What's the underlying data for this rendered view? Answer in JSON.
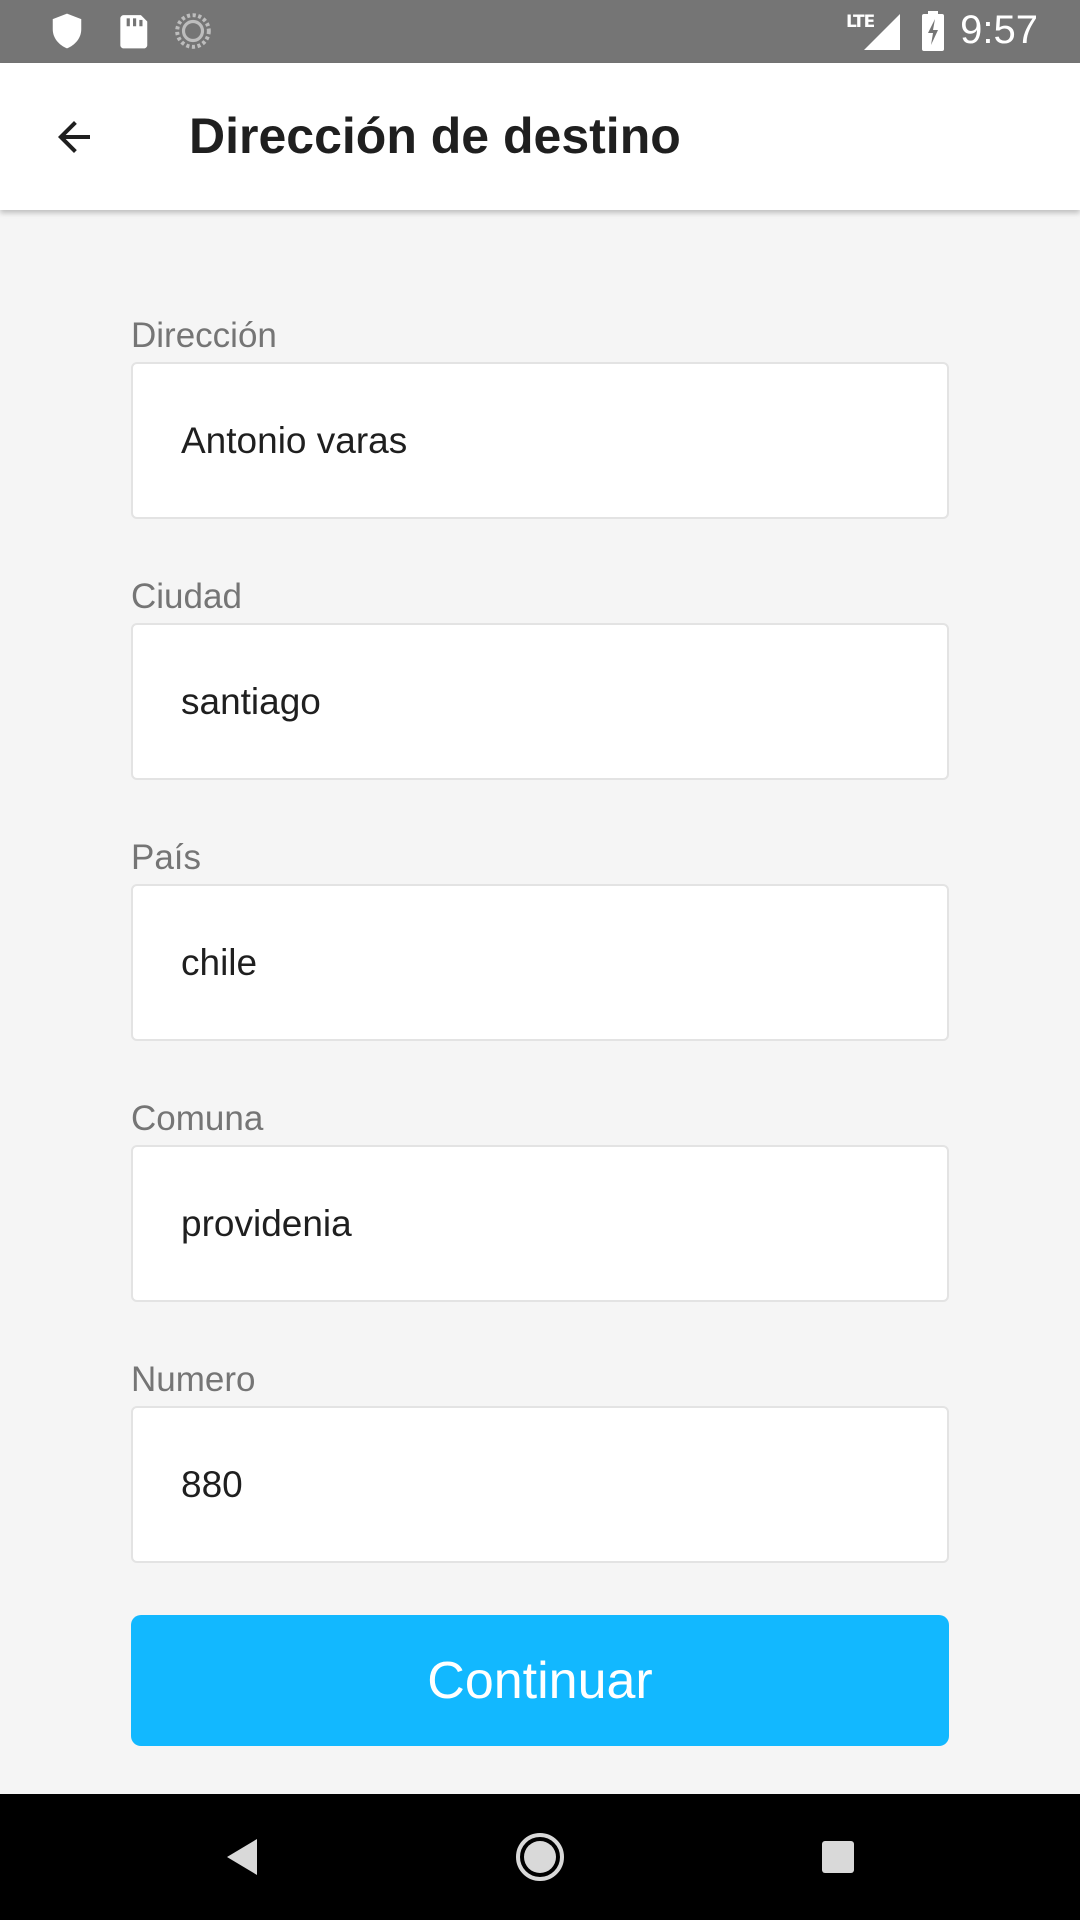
{
  "status_bar": {
    "time": "9:57",
    "network": "LTE",
    "icons": [
      "shield-icon",
      "sd-card-icon",
      "sync-icon",
      "signal-icon",
      "battery-charging-icon"
    ]
  },
  "app_bar": {
    "title": "Dirección de destino",
    "back_icon": "arrow-back-icon"
  },
  "form": {
    "fields": [
      {
        "label": "Dirección",
        "value": "Antonio varas"
      },
      {
        "label": "Ciudad",
        "value": "santiago"
      },
      {
        "label": "País",
        "value": "chile"
      },
      {
        "label": "Comuna",
        "value": "providenia"
      },
      {
        "label": "Numero",
        "value": "880"
      }
    ],
    "submit_label": "Continuar"
  },
  "nav_bar": {
    "icons": [
      "nav-back-icon",
      "nav-home-icon",
      "nav-recents-icon"
    ]
  },
  "colors": {
    "accent": "#12b8ff",
    "status_bar": "#757575",
    "background": "#f5f5f5"
  }
}
